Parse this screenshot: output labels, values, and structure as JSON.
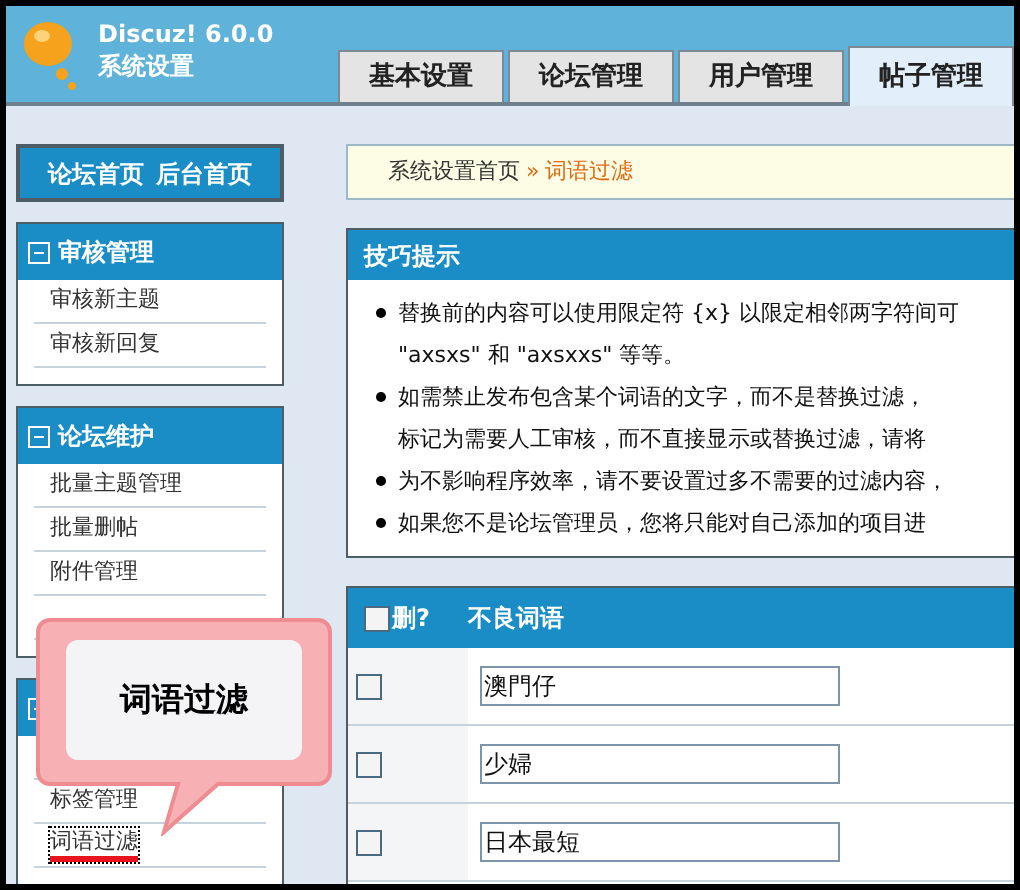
{
  "app": {
    "name": "Discuz! 6.0.0",
    "subtitle": "系统设置"
  },
  "tabs": [
    {
      "label": "基本设置",
      "selected": false
    },
    {
      "label": "论坛管理",
      "selected": false
    },
    {
      "label": "用户管理",
      "selected": false
    },
    {
      "label": "帖子管理",
      "selected": true
    }
  ],
  "sidebar": {
    "top_links": [
      "论坛首页",
      "后台首页"
    ],
    "sections": [
      {
        "title": "审核管理",
        "expanded": true,
        "items": [
          {
            "label": "审核新主题",
            "selected": false
          },
          {
            "label": "审核新回复",
            "selected": false
          }
        ]
      },
      {
        "title": "论坛维护",
        "expanded": true,
        "items": [
          {
            "label": "批量主题管理",
            "selected": false
          },
          {
            "label": "批量删帖",
            "selected": false
          },
          {
            "label": "附件管理",
            "selected": false
          }
        ]
      },
      {
        "expanded": true,
        "items": [
          {
            "label": "标签管理",
            "selected": false
          },
          {
            "label": "词语过滤",
            "selected": true
          }
        ]
      }
    ]
  },
  "breadcrumb": {
    "home": "系统设置首页",
    "separator": "»",
    "current": "词语过滤"
  },
  "tips": {
    "title": "技巧提示",
    "bullets": [
      {
        "lines": [
          "替换前的内容可以使用限定符 {x} 以限定相邻两字符间可",
          "\"axsxs\" 和 \"axsxxs\" 等等。"
        ]
      },
      {
        "lines": [
          "如需禁止发布包含某个词语的文字，而不是替换过滤，",
          "标记为需要人工审核，而不直接显示或替换过滤，请将"
        ]
      },
      {
        "lines": [
          "为不影响程序效率，请不要设置过多不需要的过滤内容，"
        ]
      },
      {
        "lines": [
          "如果您不是论坛管理员，您将只能对自己添加的项目进"
        ]
      }
    ]
  },
  "table": {
    "columns": [
      "删?",
      "不良词语"
    ],
    "select_all_checked": false,
    "rows": [
      {
        "checked": false,
        "word": "澳門仔"
      },
      {
        "checked": false,
        "word": "少婦"
      },
      {
        "checked": false,
        "word": "日本最短"
      }
    ]
  },
  "callout": {
    "text": "词语过滤"
  }
}
